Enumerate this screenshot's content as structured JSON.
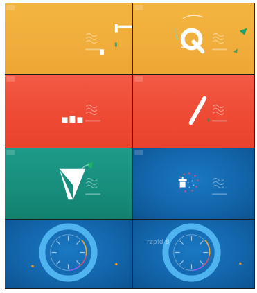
{
  "watermark": {
    "text": "rzpid 8"
  },
  "colors": {
    "yellow": "#f0ad3b",
    "red": "#ee4a34",
    "teal": "#178d7c",
    "blue": "#1366ac",
    "ring": "#4fb3f0"
  },
  "icons": {
    "corner_tag": "corner-tag-icon",
    "wave_logo": "wave-logo-icon",
    "q_glyph": "q-glyph-icon",
    "check_glyph": "check-glyph-icon",
    "dial_ring": "dial-ring-icon"
  }
}
